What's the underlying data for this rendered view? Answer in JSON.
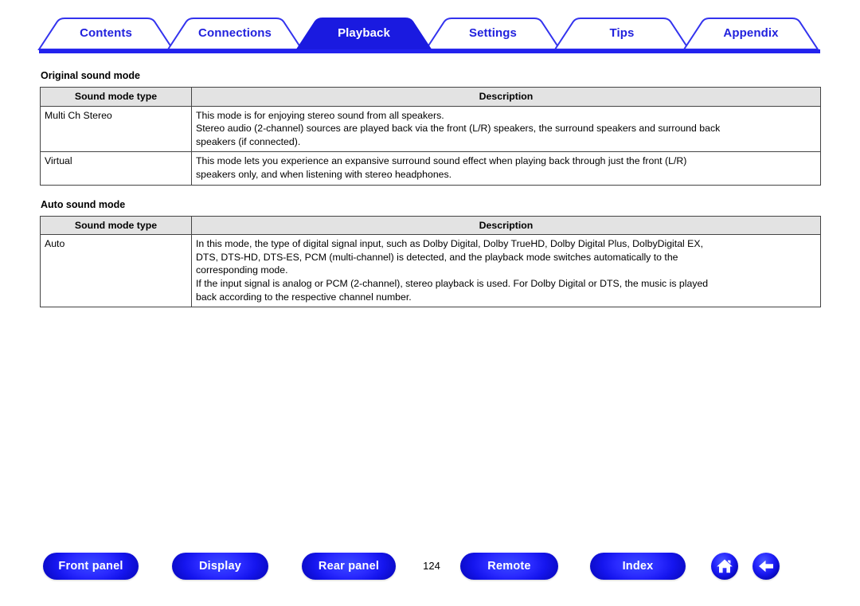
{
  "nav_tabs": {
    "items": [
      {
        "label": "Contents",
        "active": false
      },
      {
        "label": "Connections",
        "active": false
      },
      {
        "label": "Playback",
        "active": true
      },
      {
        "label": "Settings",
        "active": false
      },
      {
        "label": "Tips",
        "active": false
      },
      {
        "label": "Appendix",
        "active": false
      }
    ],
    "active_bg": "#1a1ae0",
    "inactive_bg": "#ffffff",
    "border_color": "#3333ee",
    "active_text": "#ffffff",
    "inactive_text": "#2222dd",
    "underline_color": "#2222ee"
  },
  "main": {
    "sections": [
      {
        "title": "Original sound mode",
        "columns": [
          "Sound mode type",
          "Description"
        ],
        "rows": [
          {
            "type": "Multi Ch Stereo",
            "description_lines": [
              "This mode is for enjoying stereo sound from all speakers.",
              "Stereo audio (2-channel) sources are played back via the front (L/R) speakers, the surround speakers and surround back",
              "speakers (if connected)."
            ]
          },
          {
            "type": "Virtual",
            "description_lines": [
              "This mode lets you experience an expansive surround sound effect when playing back through just the front (L/R)",
              "speakers only, and when listening with stereo headphones."
            ]
          }
        ]
      },
      {
        "title": "Auto sound mode",
        "columns": [
          "Sound mode type",
          "Description"
        ],
        "rows": [
          {
            "type": "Auto",
            "description_lines": [
              "In this mode, the type of digital signal input, such as Dolby Digital, Dolby TrueHD, Dolby Digital Plus, DolbyDigital EX,",
              "DTS, DTS-HD, DTS-ES, PCM (multi-channel) is detected, and the playback mode switches automatically to the",
              "corresponding mode.",
              "If the input signal is analog or PCM (2-channel), stereo playback is used. For Dolby Digital or DTS, the music is played",
              "back according to the respective channel number."
            ]
          }
        ]
      }
    ],
    "table_header_bg": "#e3e3e3",
    "table_border": "#444444"
  },
  "footer": {
    "buttons": [
      {
        "label": "Front panel"
      },
      {
        "label": "Display"
      },
      {
        "label": "Rear panel"
      },
      {
        "label": "Remote"
      },
      {
        "label": "Index"
      }
    ],
    "page_number": "124",
    "icons": [
      {
        "name": "home-icon",
        "glyph": "⌂"
      },
      {
        "name": "back-arrow-icon",
        "glyph": "←"
      }
    ],
    "button_color": "#1e1eee"
  }
}
